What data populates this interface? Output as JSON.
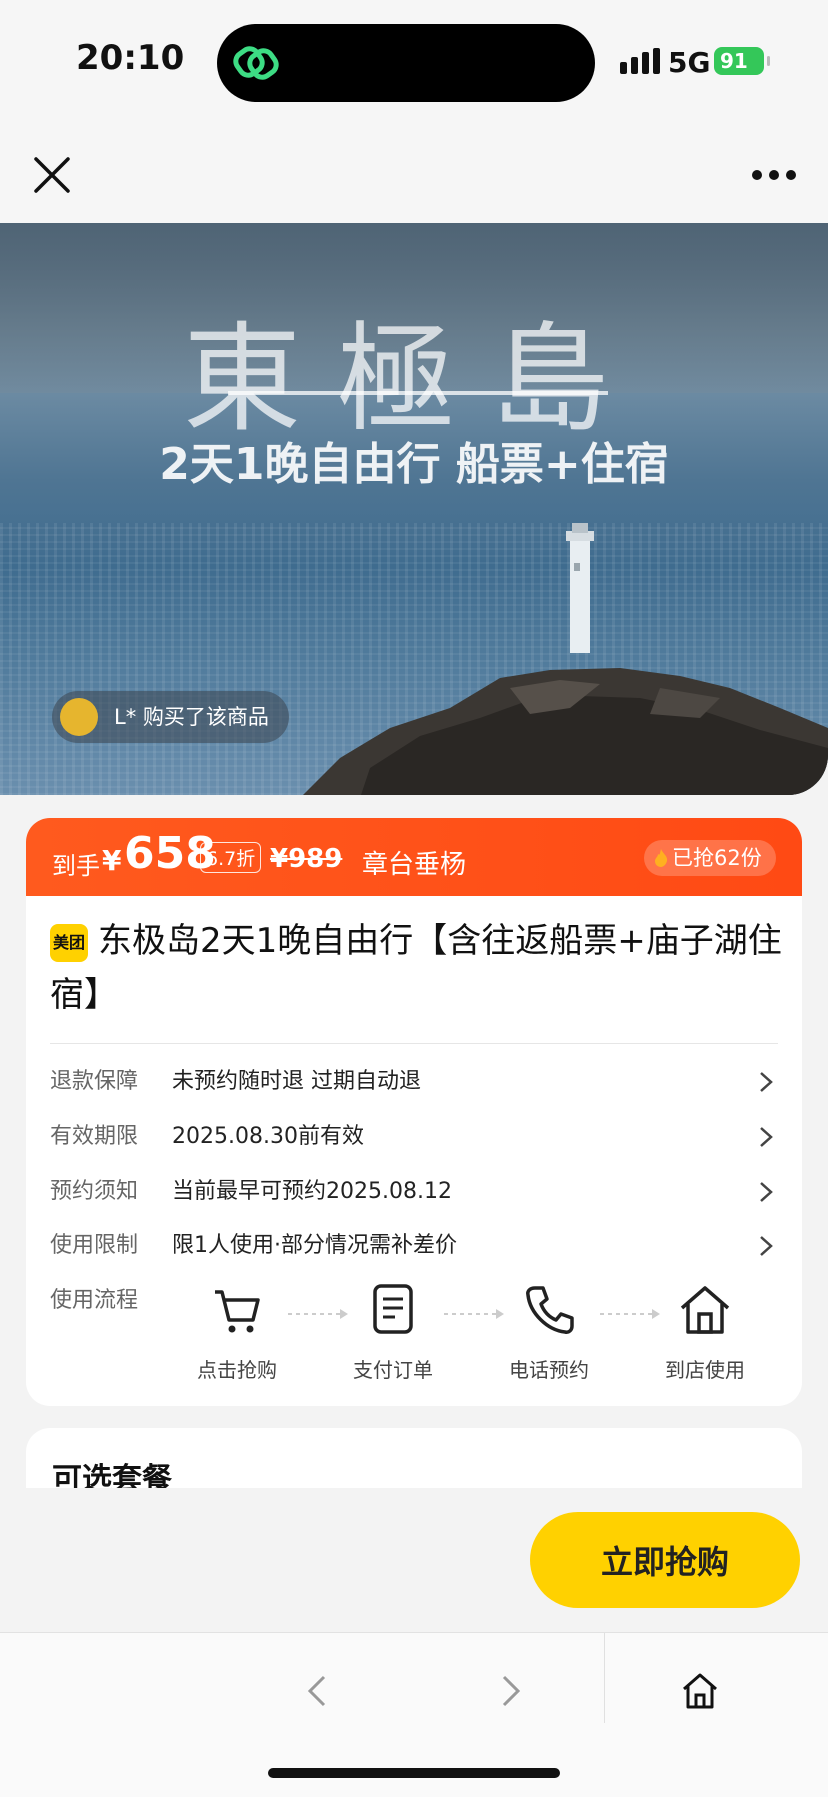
{
  "status_bar": {
    "time": "20:10",
    "network": "5G",
    "battery": "91"
  },
  "hero": {
    "title": "東極島",
    "subtitle": "2天1晚自由行 船票+住宿",
    "buyer_notice": "L* 购买了该商品"
  },
  "price": {
    "label": "到手",
    "currency": "¥",
    "amount": "658",
    "discount": "6.7折",
    "original": "¥989",
    "merchant": "章台垂杨",
    "sold": "已抢62份"
  },
  "product": {
    "brand": "美团",
    "title": "东极岛2天1晚自由行【含往返船票+庙子湖住宿】",
    "info": [
      {
        "label": "退款保障",
        "value": "未预约随时退 过期自动退"
      },
      {
        "label": "有效期限",
        "value": "2025.08.30前有效"
      },
      {
        "label": "预约须知",
        "value": "当前最早可预约2025.08.12"
      },
      {
        "label": "使用限制",
        "value": "限1人使用·部分情况需补差价"
      }
    ],
    "flow": {
      "label": "使用流程",
      "steps": [
        "点击抢购",
        "支付订单",
        "电话预约",
        "到店使用"
      ]
    }
  },
  "options": {
    "title": "可选套餐"
  },
  "buy_button": "立即抢购",
  "colors": {
    "accent_orange": "#ff5a1e",
    "brand_yellow": "#ffd100"
  }
}
